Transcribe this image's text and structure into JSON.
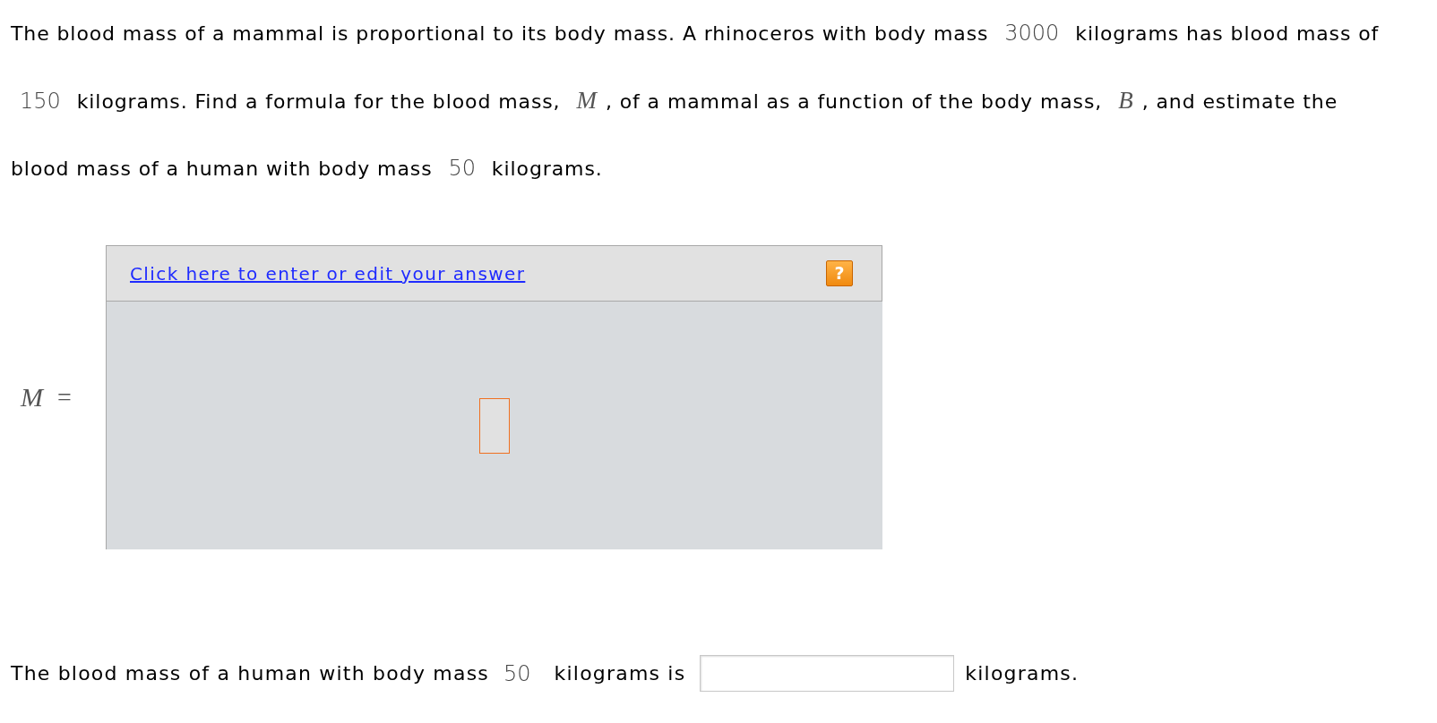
{
  "problem": {
    "segments": [
      {
        "kind": "text",
        "text": "The blood mass of a mammal is proportional to its body mass. A rhinoceros with body mass"
      },
      {
        "kind": "number",
        "text": "3000"
      },
      {
        "kind": "text",
        "text": "kilograms has blood mass of"
      },
      {
        "kind": "number",
        "text": "150"
      },
      {
        "kind": "text",
        "text": "kilograms. Find a formula for the blood mass,"
      },
      {
        "kind": "variable",
        "text": "M"
      },
      {
        "kind": "text",
        "text": ", of a mammal as a function of the body mass,"
      },
      {
        "kind": "variable",
        "text": "B"
      },
      {
        "kind": "text",
        "text": ", and estimate the blood mass of a human with body mass"
      },
      {
        "kind": "number",
        "text": "50"
      },
      {
        "kind": "text",
        "text": "kilograms."
      }
    ]
  },
  "formula": {
    "variable": "M",
    "sign": "=",
    "editor": {
      "link": "Click here to enter or edit your answer",
      "help": "?"
    }
  },
  "result": {
    "segments": [
      {
        "kind": "text",
        "text": "The blood mass of a human with body mass"
      },
      {
        "kind": "number",
        "text": "50"
      },
      {
        "kind": "text",
        "text": "kilograms is"
      },
      {
        "kind": "input"
      },
      {
        "kind": "text",
        "text": "kilograms."
      }
    ]
  }
}
